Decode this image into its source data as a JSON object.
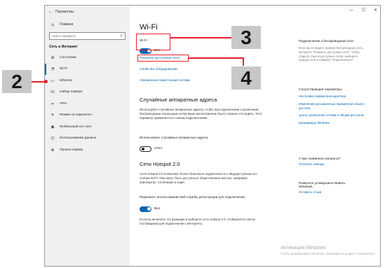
{
  "window": {
    "title": "Параметры",
    "back_glyph": "←",
    "minimize": "—",
    "maximize": "☐",
    "close": "✕"
  },
  "sidebar": {
    "home": "Главная",
    "search_placeholder": "Найти параметр",
    "section": "Сеть и Интернет",
    "items": [
      {
        "label": "Состояние",
        "icon": "globe-icon",
        "glyph": "⊕"
      },
      {
        "label": "Wi-Fi",
        "icon": "wifi-icon",
        "glyph": "◔"
      },
      {
        "label": "Ethernet",
        "icon": "ethernet-icon",
        "glyph": "▭"
      },
      {
        "label": "Набор номера",
        "icon": "phone-icon",
        "glyph": "☏"
      },
      {
        "label": "VPN",
        "icon": "vpn-icon",
        "glyph": "∞"
      },
      {
        "label": "Режим «в самолете»",
        "icon": "airplane-icon",
        "glyph": "✈"
      },
      {
        "label": "Мобильный хот-спот",
        "icon": "hotspot-icon",
        "glyph": "◉"
      },
      {
        "label": "Использование данных",
        "icon": "data-usage-icon",
        "glyph": "◴"
      },
      {
        "label": "Прокси-сервер",
        "icon": "globe-icon",
        "glyph": "⊕"
      }
    ]
  },
  "main": {
    "title": "Wi-Fi",
    "wifi_label": "Wi-Fi",
    "wifi_state": "Вкл.",
    "show_networks": "Показать доступные сети",
    "hardware_props": "Свойства оборудования",
    "manage_networks": "Управление известными сетями",
    "random_heading": "Случайные аппаратные адреса",
    "random_para": "Используйте случайные аппаратные адреса, чтобы при подключении к различным беспроводным локальным сетям ваше расположение было сложнее отследить. Этот параметр применяется к новым подключениям.",
    "random_label": "Использовать случайные аппаратные адреса",
    "random_state": "Откл.",
    "hotspot_heading": "Сети Hotspot 2.0",
    "hotspot_para": "Сети Hotspot 2.0 позволяют более безопасно подключаться к общедоступным хот-спотам Wi-Fi. Они могут быть доступны в общественных местах, например аэропортах, гостиницах и кафе.",
    "hotspot_label": "Разрешить использование веб-службы регистрации для подключения",
    "hotspot_state": "Вкл.",
    "hotspot_note": "Если вы включите эту функцию и выберете сеть Hotspot 2.0, отобразится список поставщиков для подключения к Интернету."
  },
  "right": {
    "sec1_heading": "Подключение к беспроводной сети",
    "sec1_text": "Если вы не видите нужную беспроводную сеть, выберите \"Показать доступные сети\", чтобы открыть список доступных сетей, выберите нужную сеть и нажмите \"Подключиться\".",
    "sec2_heading": "Сопутствующие параметры",
    "sec2_links": [
      "Настройка параметров адаптера",
      "Изменение расширенных параметров общего доступа",
      "Центр управления сетями и общим доступом",
      "Брандмауэр Windows"
    ],
    "sec3_heading": "У вас появились вопросы?",
    "sec3_link": "Получить помощь",
    "sec4_heading": "Помогите усовершенствовать Windows.",
    "sec4_link": "Оставить отзыв"
  },
  "watermark": {
    "line1": "Активация Windows",
    "line2": "Чтобы активировать Windows, перейдите в раздел \"Параметры\"."
  },
  "callouts": {
    "c2": "2",
    "c3": "3",
    "c4": "4"
  },
  "colors": {
    "accent": "#0063b1",
    "callout_line": "#e8202a",
    "callout_box": "#c8c8c8"
  }
}
